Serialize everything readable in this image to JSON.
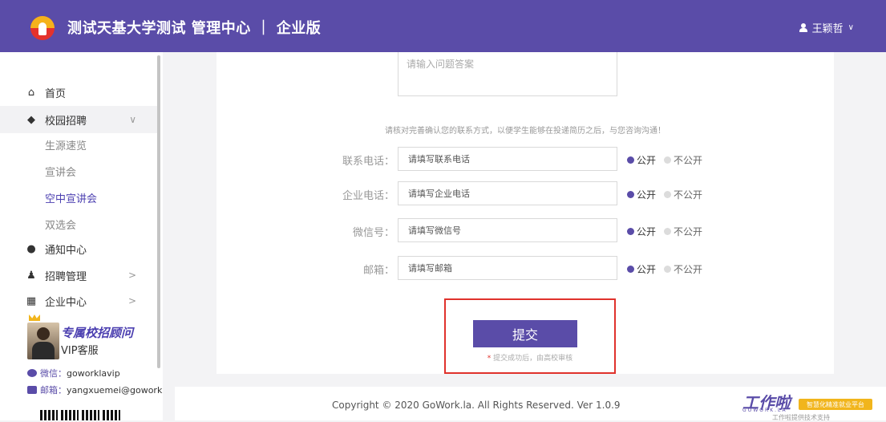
{
  "header": {
    "title": "测试天基大学测试 管理中心 ｜ 企业版",
    "user_name": "王颖哲",
    "user_chevron": "∨"
  },
  "sidebar": {
    "items": [
      {
        "label": "首页",
        "icon": "home-icon"
      },
      {
        "label": "校园招聘",
        "icon": "graduation-cap-icon",
        "arrow": "∨"
      },
      {
        "label": "通知中心",
        "icon": "chat-bubble-icon"
      },
      {
        "label": "招聘管理",
        "icon": "user-icon",
        "arrow": ">"
      },
      {
        "label": "企业中心",
        "icon": "building-icon",
        "arrow": ">"
      }
    ],
    "sub_items": [
      "生源速览",
      "宣讲会",
      "空中宣讲会",
      "双选会"
    ],
    "vip": {
      "title": "专属校招顾问",
      "subtitle": "VIP客服"
    },
    "contacts": [
      {
        "label": "微信：",
        "value": "goworklavip"
      },
      {
        "label": "邮箱：",
        "value": "yangxuemei@gowork.l"
      }
    ]
  },
  "form": {
    "answer_placeholder": "请输入问题答案",
    "hint": "请核对完善确认您的联系方式，以便学生能够在投递简历之后，与您咨询沟通！",
    "fields": [
      {
        "label": "联系电话：",
        "placeholder": "请填写联系电话"
      },
      {
        "label": "企业电话：",
        "placeholder": "请填写企业电话"
      },
      {
        "label": "微信号：",
        "placeholder": "请填写微信号"
      },
      {
        "label": "邮箱：",
        "placeholder": "请填写邮箱"
      }
    ],
    "public_label": "公开",
    "private_label": "不公开",
    "submit_label": "提交",
    "submit_note": "提交成功后，由高校审核",
    "submit_note_star": "*"
  },
  "footer": {
    "copyright": "Copyright © 2020 GoWork.la. All Rights Reserved. Ver 1.0.9",
    "brand_logo": "工作啦",
    "brand_sub": "GOWORK.LA",
    "brand_badge": "智慧化精准就业平台",
    "brand_tech": "工作啦提供技术支持"
  },
  "colors": {
    "brand": "#5a4ca8",
    "highlight_border": "#e0322c",
    "badge": "#f1b51c"
  }
}
